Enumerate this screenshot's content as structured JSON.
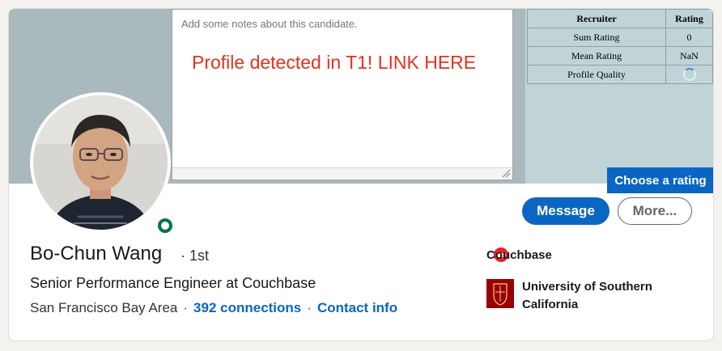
{
  "notes": {
    "placeholder": "Add some notes about this candidate.",
    "detected_link": "Profile detected in T1! LINK HERE"
  },
  "rating_table": {
    "headers": [
      "Recruiter",
      "Rating"
    ],
    "rows": [
      {
        "label": "Sum Rating",
        "value": "0"
      },
      {
        "label": "Mean Rating",
        "value": "NaN"
      },
      {
        "label": "Profile Quality",
        "value": ""
      }
    ]
  },
  "choose_rating_label": "Choose a rating",
  "actions": {
    "message_label": "Message",
    "more_label": "More..."
  },
  "profile": {
    "name": "Bo-Chun Wang",
    "degree": "· 1st",
    "headline": "Senior Performance Engineer at Couchbase",
    "location": "San Francisco Bay Area",
    "connections": "392 connections",
    "contact_info": "Contact info"
  },
  "experience": {
    "company": "Couchbase",
    "school": "University of Southern California"
  },
  "colors": {
    "brand_blue": "#0a66c2",
    "alert_red": "#e8311a",
    "online_green": "#057642",
    "cover": "#a9b9bd"
  }
}
